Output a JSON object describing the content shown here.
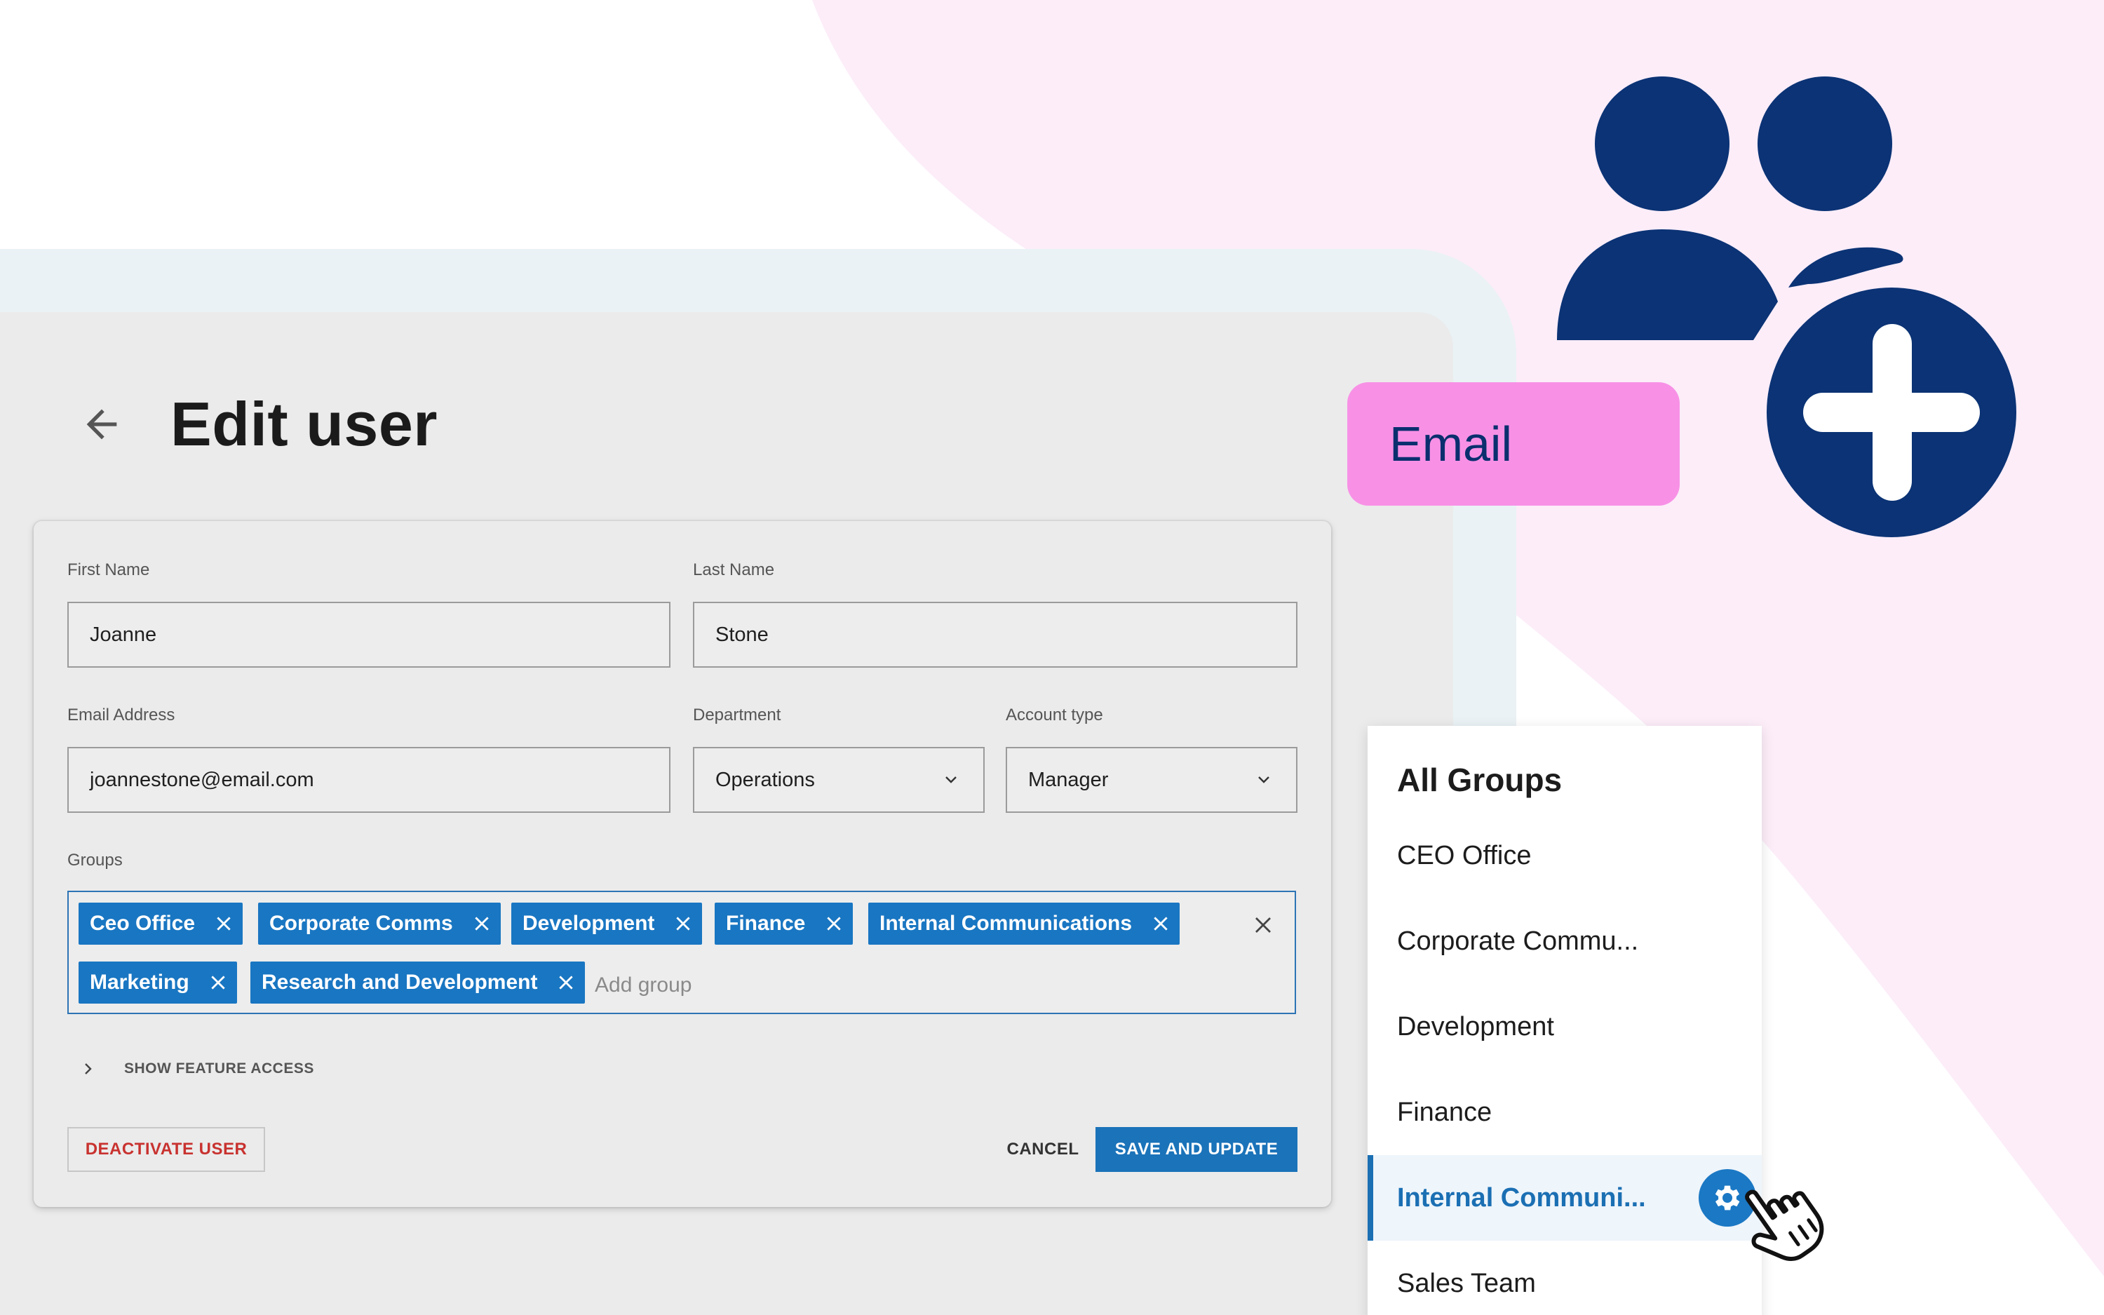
{
  "page": {
    "title": "Edit user",
    "back_icon": "arrow-left-icon"
  },
  "form": {
    "first_name": {
      "label": "First Name",
      "value": "Joanne"
    },
    "last_name": {
      "label": "Last Name",
      "value": "Stone"
    },
    "email": {
      "label": "Email Address",
      "value": "joannestone@email.com"
    },
    "department": {
      "label": "Department",
      "value": "Operations"
    },
    "account_type": {
      "label": "Account type",
      "value": "Manager"
    },
    "groups": {
      "label": "Groups",
      "chips": [
        "Ceo Office",
        "Corporate Comms",
        "Development",
        "Finance",
        "Internal Communications",
        "Marketing",
        "Research and Development"
      ],
      "placeholder": "Add group"
    },
    "feature_access_label": "SHOW FEATURE ACCESS",
    "deactivate_label": "DEACTIVATE USER",
    "cancel_label": "CANCEL",
    "save_label": "SAVE AND UPDATE"
  },
  "email_tag": {
    "label": "Email"
  },
  "dropdown": {
    "title": "All Groups",
    "items": [
      "CEO Office",
      "Corporate Commu...",
      "Development",
      "Finance",
      "Internal Communi...",
      "Sales Team"
    ],
    "active_index": 4
  },
  "colors": {
    "accent": "#1b73b9",
    "navy": "#0b3375",
    "pink": "#f891e6",
    "danger": "#c8322f",
    "bg_blob": "#fcedf9"
  }
}
